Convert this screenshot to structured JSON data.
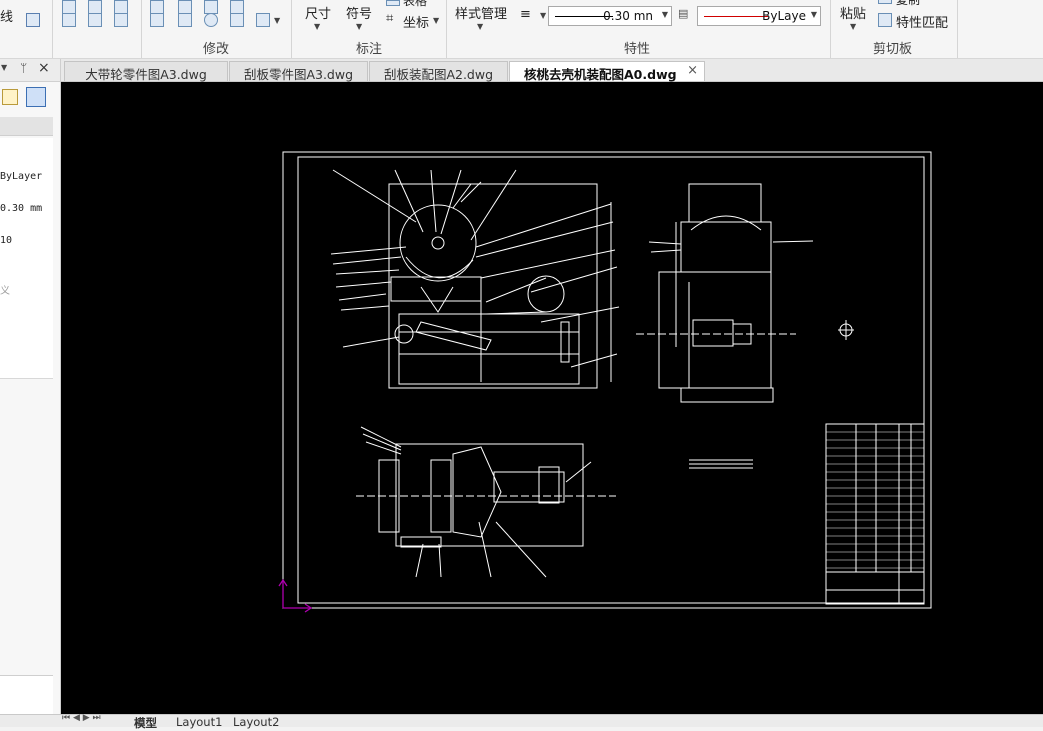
{
  "ribbon": {
    "line_label": "线",
    "groups": {
      "modify": "修改",
      "annotation": "标注",
      "properties": "特性",
      "clipboard": "剪切板"
    },
    "dimension_label": "尺寸",
    "symbol_label": "符号",
    "table_label": "表格",
    "coord_label": "坐标",
    "style_manager_label": "样式管理",
    "lineweight_value": "0.30 mn",
    "linetype_value": "ByLaye",
    "paste_label": "粘贴",
    "copy_label": "复制",
    "match_props_label": "特性匹配",
    "colors": {
      "linetype_red": "#d00000"
    }
  },
  "tabs": [
    {
      "label": "大带轮零件图A3.dwg"
    },
    {
      "label": "刮板零件图A3.dwg"
    },
    {
      "label": "刮板装配图A2.dwg"
    },
    {
      "label": "核桃去壳机装配图A0.dwg",
      "active": true
    }
  ],
  "tab_close": "×",
  "left_panel": {
    "pin": "ᛘ",
    "close": "×",
    "rows": [
      "ByLayer",
      "0.30 mm",
      "10",
      "",
      "义",
      "",
      "",
      ""
    ]
  },
  "layouts": [
    {
      "label": "模型",
      "active": true
    },
    {
      "label": "Layout1"
    },
    {
      "label": "Layout2"
    }
  ]
}
